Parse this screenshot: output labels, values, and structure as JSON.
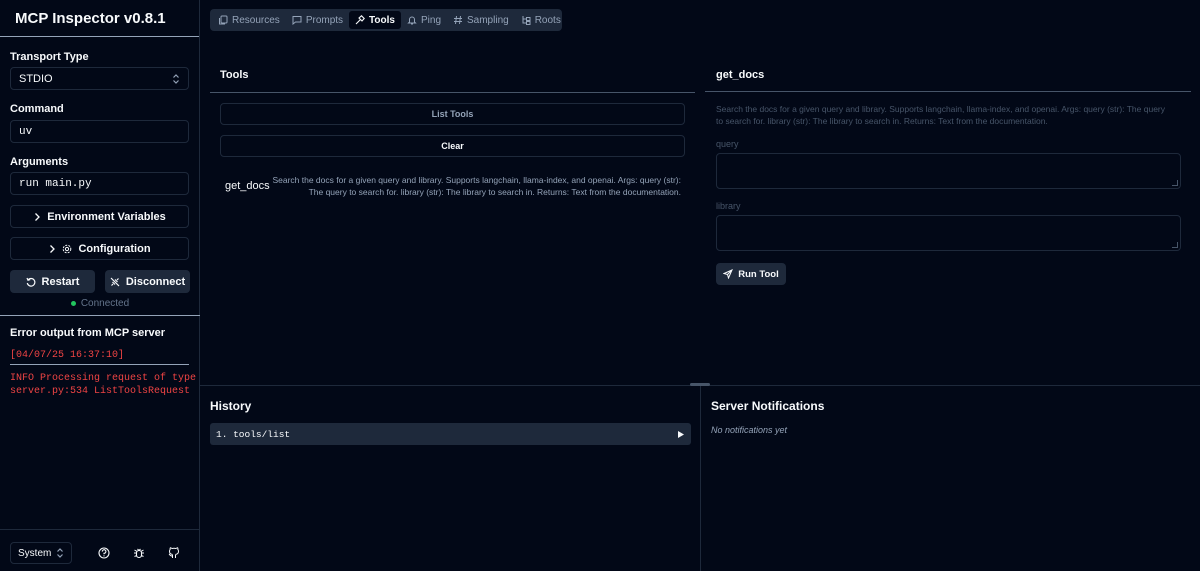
{
  "app": {
    "title": "MCP Inspector v0.8.1"
  },
  "sidebar": {
    "transport_label": "Transport Type",
    "transport_value": "STDIO",
    "command_label": "Command",
    "command_value": "uv",
    "arguments_label": "Arguments",
    "arguments_value": "run main.py",
    "env_button": "Environment Variables",
    "config_button": "Configuration",
    "restart_button": "Restart",
    "disconnect_button": "Disconnect",
    "status_text": "Connected",
    "error_heading": "Error output from MCP server",
    "error_lines": [
      "[04/07/25 16:37:10]",
      "INFO Processing request of type",
      "server.py:534 ListToolsRequest"
    ],
    "theme_value": "System"
  },
  "tabs": [
    {
      "label": "Resources",
      "icon": "files-icon"
    },
    {
      "label": "Prompts",
      "icon": "message-square-icon"
    },
    {
      "label": "Tools",
      "icon": "hammer-icon"
    },
    {
      "label": "Ping",
      "icon": "bell-icon"
    },
    {
      "label": "Sampling",
      "icon": "hash-icon"
    },
    {
      "label": "Roots",
      "icon": "folder-tree-icon"
    }
  ],
  "tools_panel": {
    "title": "Tools",
    "list_button": "List Tools",
    "clear_button": "Clear",
    "tool_name": "get_docs",
    "tool_desc_1": "Search the docs for a given query and library. Supports langchain, llama-index, and openai. Args: query (str):",
    "tool_desc_2": "The query to search for. library (str): The library to search in. Returns: Text from the documentation."
  },
  "detail_panel": {
    "title": "get_docs",
    "desc_1": "Search the docs for a given query and library. Supports langchain, llama-index, and openai. Args: query (str): The query",
    "desc_2": "to search for. library (str): The library to search in. Returns: Text from the documentation.",
    "query_label": "query",
    "library_label": "library",
    "run_button": "Run Tool"
  },
  "history": {
    "title": "History",
    "item": "1. tools/list"
  },
  "notifications": {
    "title": "Server Notifications",
    "empty": "No notifications yet"
  },
  "colors": {
    "background": "#020817",
    "border": "#1e293b",
    "error": "#ef4444",
    "success": "#22c55e"
  }
}
